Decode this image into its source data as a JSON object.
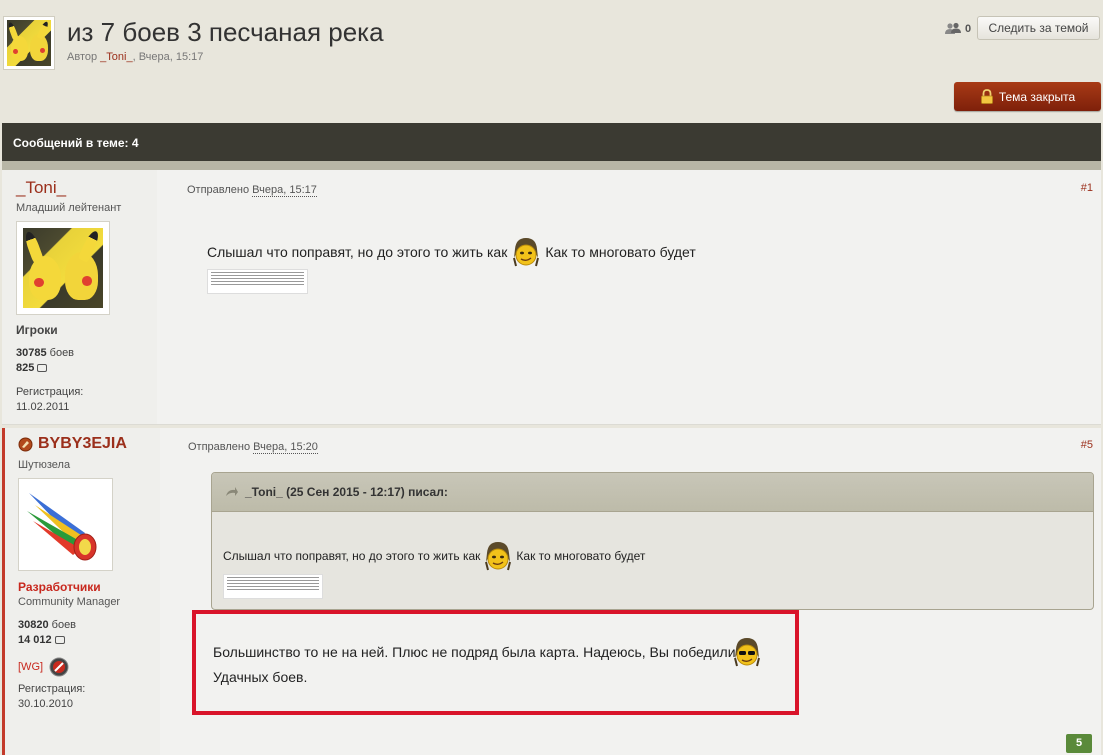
{
  "topic": {
    "title": "из 7 боев 3 песчаная река",
    "meta_prefix": "Автор ",
    "meta_author": "_Toni_",
    "meta_suffix": ", Вчера, 15:17"
  },
  "header_actions": {
    "followers_count": "0",
    "follow_label": "Следить за темой",
    "closed_label": "Тема закрыта"
  },
  "topic_bar": {
    "count_label": "Сообщений в теме: 4"
  },
  "posts": [
    {
      "username": "_Toni_",
      "rank": "Младший лейтенант",
      "group": "Игроки",
      "battles_num": "30785",
      "battles_label": " боев",
      "comments": "825",
      "reg_label": "Регистрация:",
      "reg_date": "11.02.2011",
      "posted_prefix": "Отправлено ",
      "posted_date": "Вчера, 15:17",
      "post_number": "#1",
      "text_before": "Слышал что поправят, но до этого то жить как",
      "text_after": "Как то многовато будет"
    },
    {
      "username": "BYBY3EJIA",
      "rank": "Шутюзела",
      "group": "Разработчики",
      "subgroup": "Community Manager",
      "battles_num": "30820",
      "battles_label": " боев",
      "comments": "14 012",
      "clan": "[WG]",
      "reg_label": "Регистрация:",
      "reg_date": "30.10.2010",
      "posted_prefix": "Отправлено ",
      "posted_date": "Вчера, 15:20",
      "post_number": "#5",
      "quote_header": "_Toni_ (25 Сен 2015 - 12:17) писал:",
      "quote_before": "Слышал что поправят, но до этого то жить как",
      "quote_after": "Как то многовато будет",
      "reply_line1": "Большинство то не на ней. Плюс не подряд была карта. Надеюсь, Вы победили",
      "reply_line2": "Удачных боев."
    }
  ],
  "reputation_badge": "5",
  "colors": {
    "accent": "#9b2f1b",
    "highlight_border": "#d9142a",
    "dark_bar": "#3b3a32",
    "closed_button": "#8f2a10",
    "reputation": "#5a8a3a"
  }
}
